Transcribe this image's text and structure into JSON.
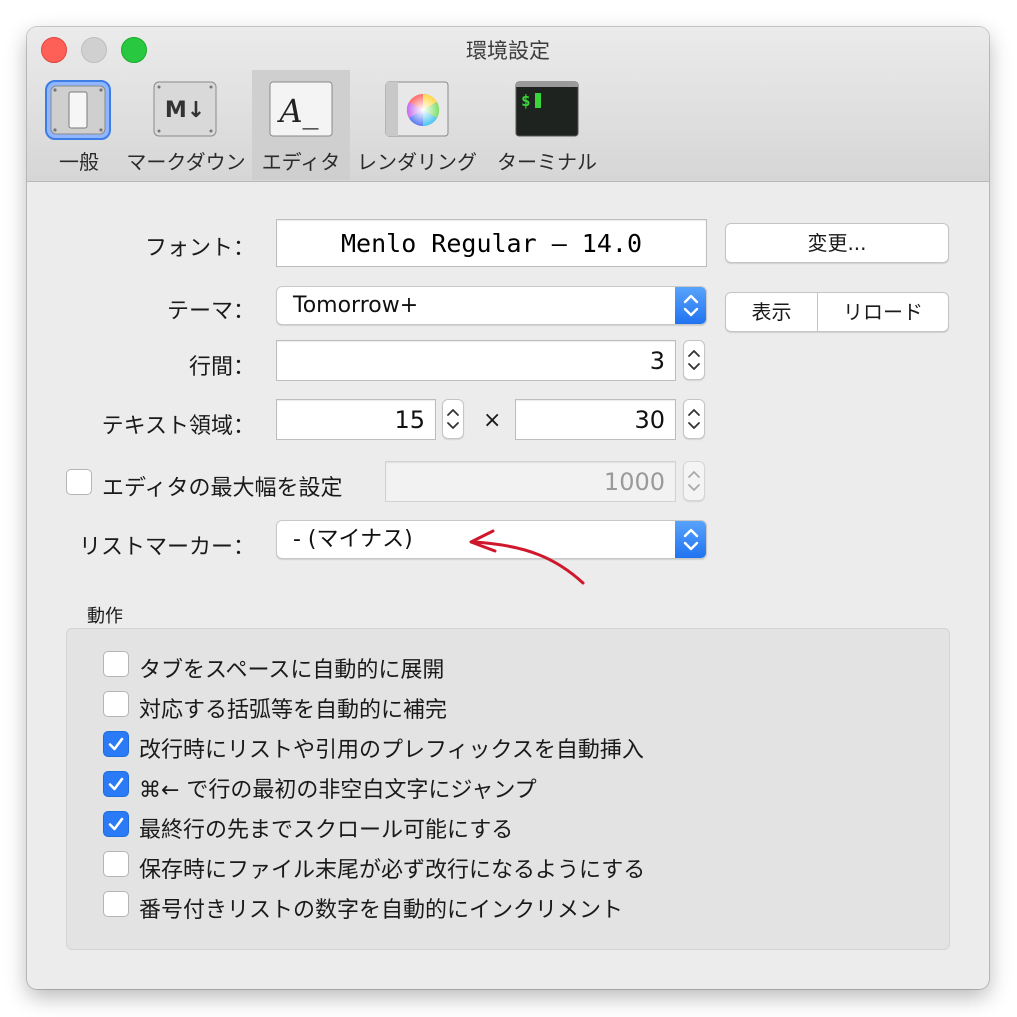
{
  "window": {
    "title": "環境設定"
  },
  "toolbar": {
    "tabs": [
      {
        "label": "一般",
        "selected": false
      },
      {
        "label": "マークダウン",
        "selected": false
      },
      {
        "label": "エディタ",
        "selected": true
      },
      {
        "label": "レンダリング",
        "selected": false
      },
      {
        "label": "ターミナル",
        "selected": false
      }
    ],
    "markdown_icon_text": "M↓",
    "editor_icon_text": "A_",
    "terminal_icon_text": "$"
  },
  "font": {
    "label": "フォント：",
    "value": "Menlo Regular – 14.0",
    "change_button": "変更..."
  },
  "theme": {
    "label": "テーマ：",
    "value": "Tomorrow+",
    "show_button": "表示",
    "reload_button": "リロード"
  },
  "line_spacing": {
    "label": "行間：",
    "value": "3"
  },
  "text_area": {
    "label": "テキスト領域：",
    "width": "15",
    "times": "×",
    "height": "30"
  },
  "max_width": {
    "label": "エディタの最大幅を設定",
    "checked": false,
    "value": "1000"
  },
  "list_marker": {
    "label": "リストマーカー：",
    "value": "- (マイナス)"
  },
  "behavior": {
    "title": "動作",
    "options": [
      {
        "label": "タブをスペースに自動的に展開",
        "checked": false
      },
      {
        "label": "対応する括弧等を自動的に補完",
        "checked": false
      },
      {
        "label": "改行時にリストや引用のプレフィックスを自動挿入",
        "checked": true
      },
      {
        "label": "⌘← で行の最初の非空白文字にジャンプ",
        "checked": true
      },
      {
        "label": "最終行の先までスクロール可能にする",
        "checked": true
      },
      {
        "label": "保存時にファイル末尾が必ず改行になるようにする",
        "checked": false
      },
      {
        "label": "番号付きリストの数字を自動的にインクリメント",
        "checked": false
      }
    ]
  },
  "colors": {
    "accent": "#2b7bf6",
    "annotation_arrow": "#d0182c"
  }
}
